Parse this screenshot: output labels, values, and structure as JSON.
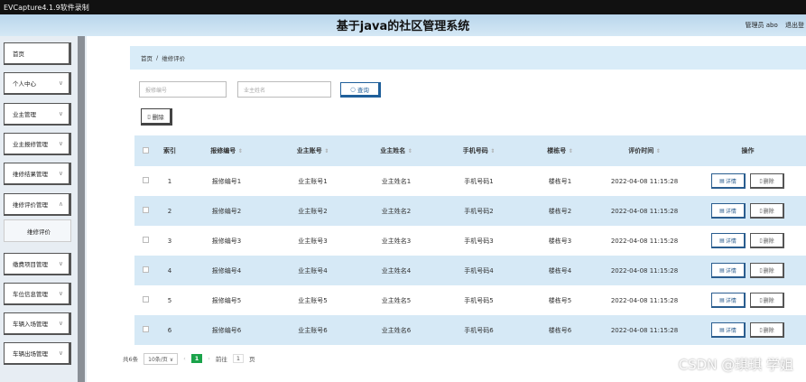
{
  "window": {
    "capture_title": "EVCapture4.1.9软件录制"
  },
  "header": {
    "title": "基于java的社区管理系统",
    "user": "管理员 abo",
    "logout": "退出登"
  },
  "sidebar": {
    "items": [
      {
        "label": "首页"
      },
      {
        "label": "个人中心"
      },
      {
        "label": "业主管理"
      },
      {
        "label": "业主报修管理"
      },
      {
        "label": "维修结果管理"
      },
      {
        "label": "维修评价管理"
      },
      {
        "label": "维修评价"
      },
      {
        "label": "缴费项目管理"
      },
      {
        "label": "车位信息管理"
      },
      {
        "label": "车辆入场管理"
      },
      {
        "label": "车辆出场管理"
      }
    ]
  },
  "breadcrumb": {
    "home": "首页",
    "sep": "/",
    "current": "维修评价"
  },
  "search": {
    "field1_placeholder": "报修编号",
    "field2_placeholder": "业主姓名",
    "button_label": "查询",
    "button_icon": "search-icon"
  },
  "toolbar": {
    "delete_label": "删除",
    "delete_icon": "trash-icon"
  },
  "table": {
    "headers": [
      "索引",
      "报修编号",
      "业主账号",
      "业主姓名",
      "手机号码",
      "楼栋号",
      "评价时间",
      "操作"
    ],
    "rows": [
      {
        "index": "1",
        "no": "报修编号1",
        "account": "业主账号1",
        "name": "业主姓名1",
        "phone": "手机号码1",
        "building": "楼栋号1",
        "time": "2022-04-08 11:15:28"
      },
      {
        "index": "2",
        "no": "报修编号2",
        "account": "业主账号2",
        "name": "业主姓名2",
        "phone": "手机号码2",
        "building": "楼栋号2",
        "time": "2022-04-08 11:15:28"
      },
      {
        "index": "3",
        "no": "报修编号3",
        "account": "业主账号3",
        "name": "业主姓名3",
        "phone": "手机号码3",
        "building": "楼栋号3",
        "time": "2022-04-08 11:15:28"
      },
      {
        "index": "4",
        "no": "报修编号4",
        "account": "业主账号4",
        "name": "业主姓名4",
        "phone": "手机号码4",
        "building": "楼栋号4",
        "time": "2022-04-08 11:15:28"
      },
      {
        "index": "5",
        "no": "报修编号5",
        "account": "业主账号5",
        "name": "业主姓名5",
        "phone": "手机号码5",
        "building": "楼栋号5",
        "time": "2022-04-08 11:15:28"
      },
      {
        "index": "6",
        "no": "报修编号6",
        "account": "业主账号6",
        "name": "业主姓名6",
        "phone": "手机号码6",
        "building": "楼栋号6",
        "time": "2022-04-08 11:15:28"
      }
    ],
    "detail_label": "详情",
    "delete_label": "删除"
  },
  "pager": {
    "total": "共6条",
    "page_size": "10条/页",
    "current_page": "1",
    "goto_label": "前往",
    "goto_value": "1",
    "page_unit": "页"
  },
  "watermark": "CSDN @琪琪 学姐",
  "colors": {
    "accent": "#1f5f9a",
    "row_alt": "#d6e9f6",
    "pager_active": "#1aa34a"
  }
}
